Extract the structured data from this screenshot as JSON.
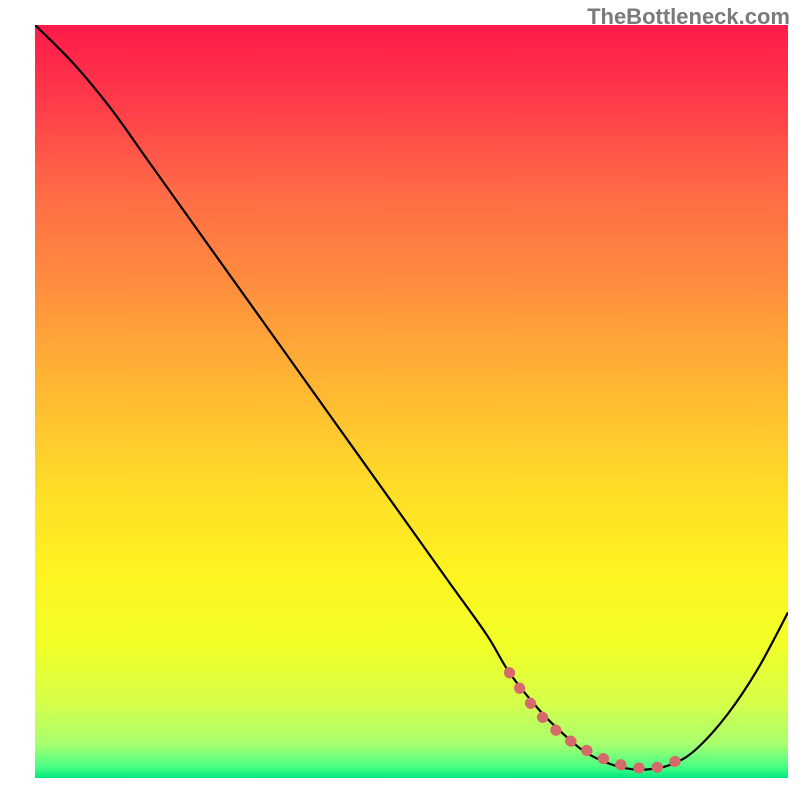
{
  "watermark": "TheBottleneck.com",
  "chart_data": {
    "type": "line",
    "title": "",
    "xlabel": "",
    "ylabel": "",
    "xlim": [
      0,
      100
    ],
    "ylim": [
      0,
      100
    ],
    "series": [
      {
        "name": "bottleneck-curve",
        "x": [
          0,
          5,
          10,
          15,
          20,
          25,
          30,
          35,
          40,
          45,
          50,
          55,
          60,
          63,
          67,
          70,
          73,
          76,
          79,
          82,
          85,
          88,
          92,
          96,
          100
        ],
        "values": [
          100,
          95,
          89,
          82,
          75,
          68,
          61,
          54,
          47,
          40,
          33,
          26,
          19,
          14,
          9,
          6,
          3.5,
          2,
          1.2,
          1.2,
          2,
          4,
          8.5,
          14.5,
          22
        ]
      },
      {
        "name": "optimal-range-marker",
        "x": [
          63,
          65,
          67,
          69,
          71,
          73,
          75,
          77,
          79,
          81,
          83,
          85,
          87
        ],
        "values": [
          14,
          11,
          8.5,
          6.5,
          5,
          3.8,
          2.8,
          2,
          1.5,
          1.3,
          1.5,
          2.2,
          3.5
        ]
      }
    ],
    "gradient_stops": [
      {
        "offset": 0.0,
        "color": "#ff1a4a"
      },
      {
        "offset": 0.1,
        "color": "#ff3a4a"
      },
      {
        "offset": 0.22,
        "color": "#ff6a46"
      },
      {
        "offset": 0.35,
        "color": "#ff8f3e"
      },
      {
        "offset": 0.48,
        "color": "#ffb733"
      },
      {
        "offset": 0.6,
        "color": "#ffd929"
      },
      {
        "offset": 0.72,
        "color": "#fff21f"
      },
      {
        "offset": 0.82,
        "color": "#f2ff26"
      },
      {
        "offset": 0.9,
        "color": "#d6ff4a"
      },
      {
        "offset": 0.955,
        "color": "#a8ff6e"
      },
      {
        "offset": 0.985,
        "color": "#4aff85"
      },
      {
        "offset": 1.0,
        "color": "#00e880"
      }
    ],
    "colors": {
      "curve": "#000000",
      "marker": "#d66a6a"
    }
  }
}
